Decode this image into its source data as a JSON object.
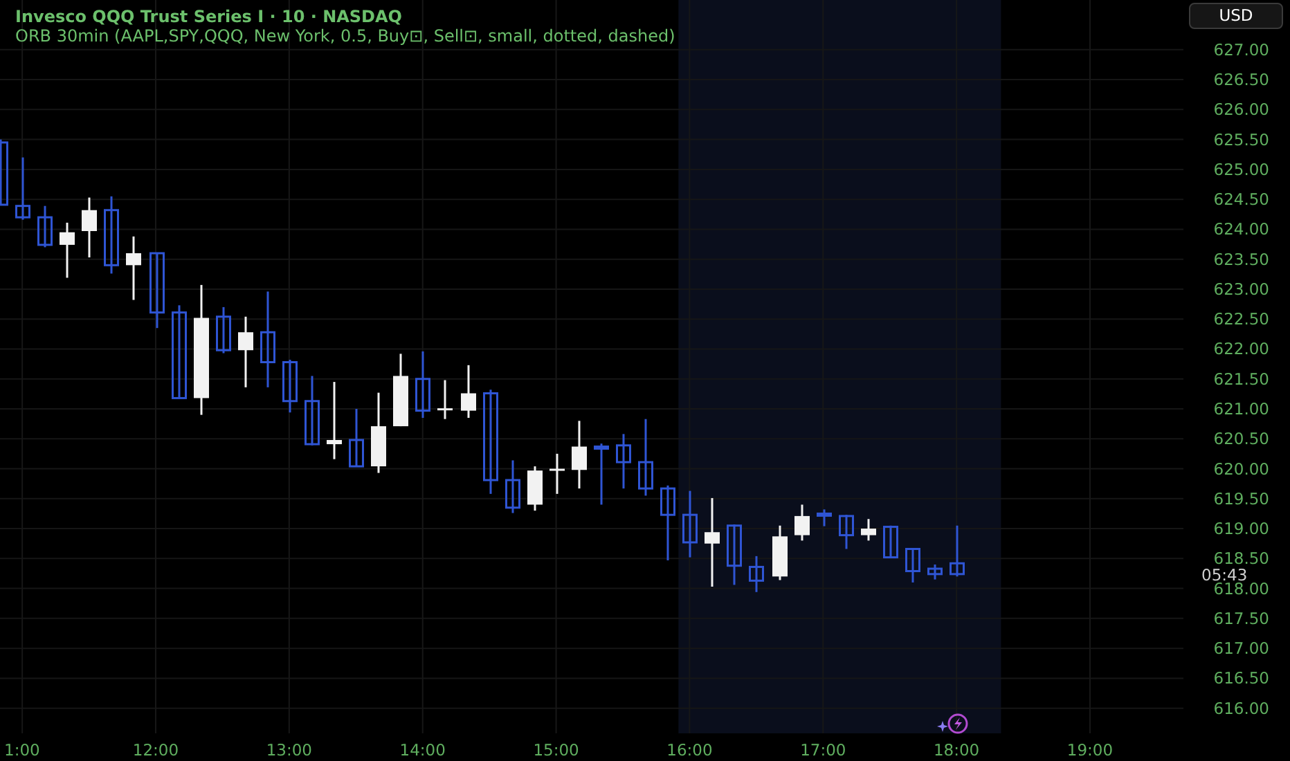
{
  "legend": {
    "symbol_line": "Invesco QQQ Trust Series I · 10 · NASDAQ",
    "indicator_line": "ORB 30min (AAPL,SPY,QQQ, New York, 0.5, Buy⊡, Sell⊡, small, dotted, dashed)"
  },
  "currency_button": "USD",
  "countdown": "05:43",
  "cut_time_label": "1:00",
  "chart_data": {
    "type": "candlestick",
    "x": [
      650,
      660,
      670,
      680,
      690,
      700,
      710,
      720,
      730,
      740,
      750,
      760,
      770,
      780,
      790,
      800,
      810,
      820,
      830,
      840,
      850,
      860,
      870,
      880,
      890,
      900,
      910,
      920,
      930,
      940,
      950,
      960,
      970,
      980,
      990,
      1000,
      1010,
      1020,
      1030,
      1040,
      1050,
      1060,
      1070,
      1080
    ],
    "ohlc": [
      [
        625.45,
        625.5,
        624.4,
        624.41
      ],
      [
        624.39,
        625.2,
        624.16,
        624.2
      ],
      [
        624.2,
        624.39,
        623.7,
        623.74
      ],
      [
        623.74,
        624.11,
        623.19,
        623.95
      ],
      [
        623.97,
        624.53,
        623.53,
        624.32
      ],
      [
        624.32,
        624.55,
        623.26,
        623.4
      ],
      [
        623.4,
        623.88,
        622.82,
        623.6
      ],
      [
        623.6,
        623.6,
        622.35,
        622.61
      ],
      [
        622.61,
        622.73,
        621.18,
        621.18
      ],
      [
        621.18,
        623.07,
        620.9,
        622.52
      ],
      [
        622.54,
        622.7,
        621.93,
        621.98
      ],
      [
        621.98,
        622.54,
        621.36,
        622.28
      ],
      [
        622.28,
        622.96,
        621.36,
        621.78
      ],
      [
        621.78,
        621.82,
        620.94,
        621.13
      ],
      [
        621.13,
        621.55,
        620.39,
        620.41
      ],
      [
        620.41,
        621.45,
        620.16,
        620.48
      ],
      [
        620.48,
        621.0,
        620.04,
        620.04
      ],
      [
        620.04,
        621.27,
        619.93,
        620.71
      ],
      [
        620.71,
        621.92,
        620.71,
        621.55
      ],
      [
        621.5,
        621.96,
        620.85,
        620.97
      ],
      [
        620.99,
        621.48,
        620.83,
        621.01
      ],
      [
        620.97,
        621.73,
        620.85,
        621.26
      ],
      [
        621.26,
        621.32,
        619.58,
        619.81
      ],
      [
        619.81,
        620.14,
        619.26,
        619.35
      ],
      [
        619.4,
        620.04,
        619.3,
        619.97
      ],
      [
        619.98,
        620.25,
        619.58,
        620.0
      ],
      [
        619.98,
        620.8,
        619.67,
        620.37
      ],
      [
        620.37,
        620.42,
        619.4,
        620.35
      ],
      [
        620.39,
        620.58,
        619.67,
        620.11
      ],
      [
        620.11,
        620.83,
        619.55,
        619.67
      ],
      [
        619.67,
        619.72,
        618.47,
        619.23
      ],
      [
        619.23,
        619.63,
        618.52,
        618.77
      ],
      [
        618.75,
        619.51,
        618.03,
        618.94
      ],
      [
        619.05,
        619.07,
        618.06,
        618.38
      ],
      [
        618.36,
        618.54,
        617.94,
        618.13
      ],
      [
        618.2,
        619.05,
        618.14,
        618.87
      ],
      [
        618.89,
        619.4,
        618.8,
        619.21
      ],
      [
        619.25,
        619.32,
        619.04,
        619.23
      ],
      [
        619.21,
        619.23,
        618.66,
        618.89
      ],
      [
        618.89,
        619.16,
        618.8,
        619.0
      ],
      [
        619.03,
        619.05,
        618.52,
        618.52
      ],
      [
        618.66,
        618.66,
        618.1,
        618.29
      ],
      [
        618.33,
        618.4,
        618.15,
        618.24
      ],
      [
        618.42,
        619.05,
        618.2,
        618.24
      ]
    ],
    "ylim": [
      615.58,
      627.83
    ],
    "grid": true,
    "xlim": [
      650,
      1182
    ],
    "xticks": [
      {
        "value": 720,
        "label": "12:00"
      },
      {
        "value": 780,
        "label": "13:00"
      },
      {
        "value": 840,
        "label": "14:00"
      },
      {
        "value": 900,
        "label": "15:00"
      },
      {
        "value": 960,
        "label": "16:00"
      },
      {
        "value": 1020,
        "label": "17:00"
      },
      {
        "value": 1080,
        "label": "18:00"
      },
      {
        "value": 1140,
        "label": "19:00"
      }
    ],
    "yticks": [
      {
        "value": 627,
        "label": "627.00"
      },
      {
        "value": 626.5,
        "label": "626.50"
      },
      {
        "value": 626,
        "label": "626.00"
      },
      {
        "value": 625.5,
        "label": "625.50"
      },
      {
        "value": 625,
        "label": "625.00"
      },
      {
        "value": 624.5,
        "label": "624.50"
      },
      {
        "value": 624,
        "label": "624.00"
      },
      {
        "value": 623.5,
        "label": "623.50"
      },
      {
        "value": 623,
        "label": "623.00"
      },
      {
        "value": 622.5,
        "label": "622.50"
      },
      {
        "value": 622,
        "label": "622.00"
      },
      {
        "value": 621.5,
        "label": "621.50"
      },
      {
        "value": 621,
        "label": "621.00"
      },
      {
        "value": 620.5,
        "label": "620.50"
      },
      {
        "value": 620,
        "label": "620.00"
      },
      {
        "value": 619.5,
        "label": "619.50"
      },
      {
        "value": 619,
        "label": "619.00"
      },
      {
        "value": 618.5,
        "label": "618.50"
      },
      {
        "value": 618,
        "label": "618.00"
      },
      {
        "value": 617.5,
        "label": "617.50"
      },
      {
        "value": 617,
        "label": "617.00"
      },
      {
        "value": 616.5,
        "label": "616.50"
      },
      {
        "value": 616,
        "label": "616.00"
      }
    ],
    "bands": [
      {
        "axis": "x",
        "from": 955,
        "to": 1100
      }
    ]
  }
}
